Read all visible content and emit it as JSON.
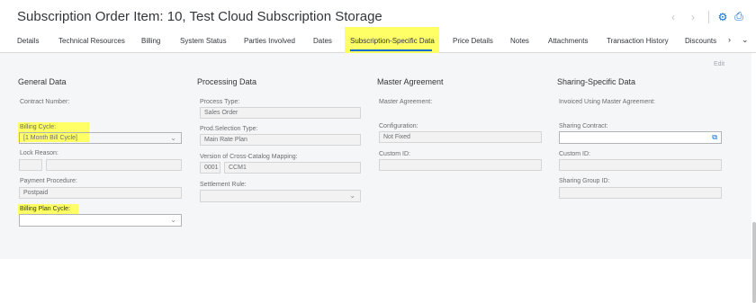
{
  "header": {
    "title": "Subscription Order Item: 10, Test Cloud Subscription Storage",
    "icons": [
      "chevron-left-icon",
      "chevron-right-icon",
      "settings-icon",
      "print-icon"
    ]
  },
  "tabs": [
    {
      "label": "Details"
    },
    {
      "label": "Technical Resources"
    },
    {
      "label": "Billing"
    },
    {
      "label": "System Status"
    },
    {
      "label": "Parties Involved"
    },
    {
      "label": "Dates"
    },
    {
      "label": "Subscription-Specific Data",
      "active": true
    },
    {
      "label": "Price Details"
    },
    {
      "label": "Notes"
    },
    {
      "label": "Attachments"
    },
    {
      "label": "Transaction History"
    },
    {
      "label": "Discounts"
    }
  ],
  "edit_label": "Edit",
  "general": {
    "title": "General Data",
    "contract_number_label": "Contract Number:",
    "billing_cycle_label": "Billing Cycle:",
    "billing_cycle_value": "[1 Month  Bill Cycle]",
    "lock_reason_label": "Lock Reason:",
    "payment_procedure_label": "Payment Procedure:",
    "payment_procedure_value": "Postpaid",
    "billing_plan_cycle_label": "Billing Plan Cycle:"
  },
  "processing": {
    "title": "Processing Data",
    "process_type_label": "Process Type:",
    "process_type_value": "Sales Order",
    "prod_selection_type_label": "Prod.Selection Type:",
    "prod_selection_type_value": "Main Rate Plan",
    "cross_catalog_label": "Version of Cross-Catalog Mapping:",
    "cross_catalog_version": "0001",
    "cross_catalog_code": "CCM1",
    "settlement_rule_label": "Settlement Rule:"
  },
  "master": {
    "title": "Master Agreement",
    "master_agreement_label": "Master Agreement:",
    "configuration_label": "Configuration:",
    "configuration_value": "Not Fixed",
    "custom_id_label": "Custom ID:"
  },
  "sharing": {
    "title": "Sharing-Specific Data",
    "invoiced_label": "Invoiced Using Master Agreement:",
    "sharing_contract_label": "Sharing Contract:",
    "custom_id_label": "Custom ID:",
    "sharing_group_id_label": "Sharing Group ID:"
  },
  "highlight_color": "#ffff66",
  "accent_color": "#0a6ed1"
}
